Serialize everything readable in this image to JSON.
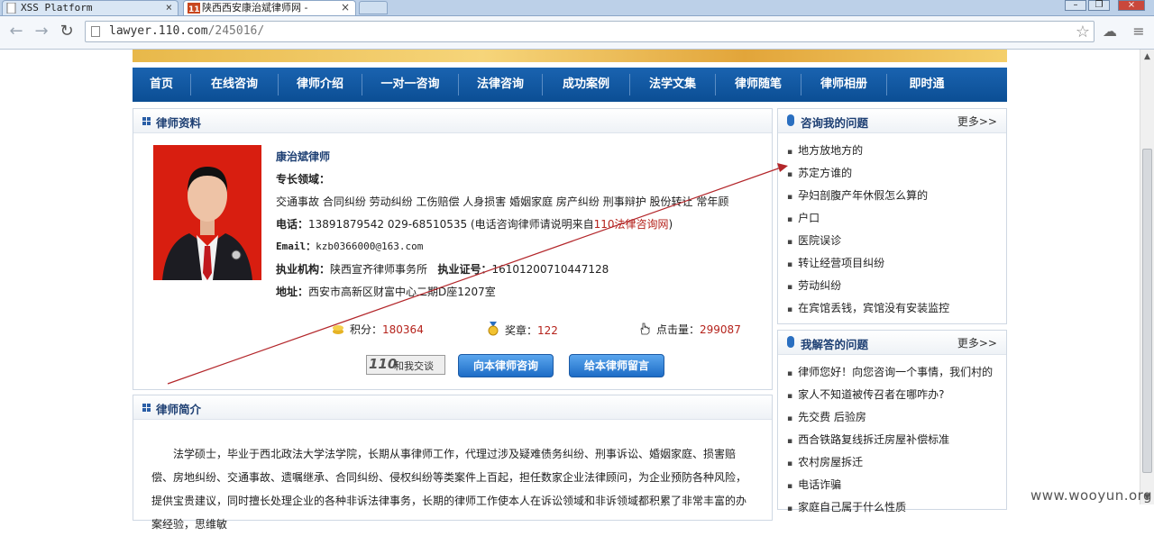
{
  "browser": {
    "tabs": [
      {
        "title": "XSS Platform"
      },
      {
        "title": "陕西西安康治斌律师网 -"
      }
    ],
    "url_host": "lawyer.110.com",
    "url_path": "/245016/"
  },
  "nav": {
    "items": [
      "首页",
      "在线咨询",
      "律师介绍",
      "一对一咨询",
      "法律咨询",
      "成功案例",
      "法学文集",
      "律师随笔",
      "律师相册",
      "即时通"
    ]
  },
  "profile": {
    "heading": "律师资料",
    "name": "康治斌律师",
    "specialty_label": "专长领域：",
    "specialties": "交通事故  合同纠纷  劳动纠纷  工伤赔偿  人身损害  婚姻家庭  房产纠纷  刑事辩护  股份转让  常年顾",
    "phone_label": "电话：",
    "phone_value": "13891879542 029-68510535 (电话咨询律师请说明来自",
    "phone_link": "110法律咨询网",
    "phone_tail": ")",
    "email_label": "Email：",
    "email_value": "kzb0366000@163.com",
    "org_label": "执业机构：",
    "org_value": "陕西宣齐律师事务所",
    "license_label": "执业证号：",
    "license_value": "16101200710447128",
    "address_label": "地址：",
    "address_value": "西安市高新区财富中心二期D座1207室",
    "points_label": "积分：",
    "points_value": "180364",
    "medal_label": "奖章：",
    "medal_value": "122",
    "clicks_label": "点击量：",
    "clicks_value": "299087",
    "chat_label": "和我交谈",
    "ask_button": "向本律师咨询",
    "message_button": "给本律师留言"
  },
  "intro": {
    "heading": "律师简介",
    "text": "法学硕士，毕业于西北政法大学法学院，长期从事律师工作，代理过涉及疑难债务纠纷、刑事诉讼、婚姻家庭、损害赔偿、房地纠纷、交通事故、遗嘱继承、合同纠纷、侵权纠纷等类案件上百起，担任数家企业法律顾问，为企业预防各种风险，提供宝贵建议，同时擅长处理企业的各种非诉法律事务，长期的律师工作使本人在诉讼领域和非诉领域都积累了非常丰富的办案经验，思维敏"
  },
  "consult": {
    "heading": "咨询我的问题",
    "more": "更多>>",
    "items": [
      "地方放地方的",
      "苏定方谁的",
      "孕妇剖腹产年休假怎么算的",
      "户口",
      "医院误诊",
      "转让经营项目纠纷",
      "劳动纠纷",
      "在宾馆丢钱，宾馆没有安装监控"
    ]
  },
  "answered": {
    "heading": "我解答的问题",
    "more": "更多>>",
    "items": [
      "律师您好！向您咨询一个事情，我们村的",
      "家人不知道被传召者在哪咋办?",
      "先交费  后验房",
      "西合铁路复线拆迁房屋补偿标准",
      "农村房屋拆迁",
      "电话诈骗",
      "家庭自己属于什么性质"
    ]
  },
  "watermark": "www.wooyun.org",
  "colors": {
    "nav_blue": "#0f5aa6",
    "accent_red": "#b5231c",
    "arrow": "#b3262a"
  }
}
